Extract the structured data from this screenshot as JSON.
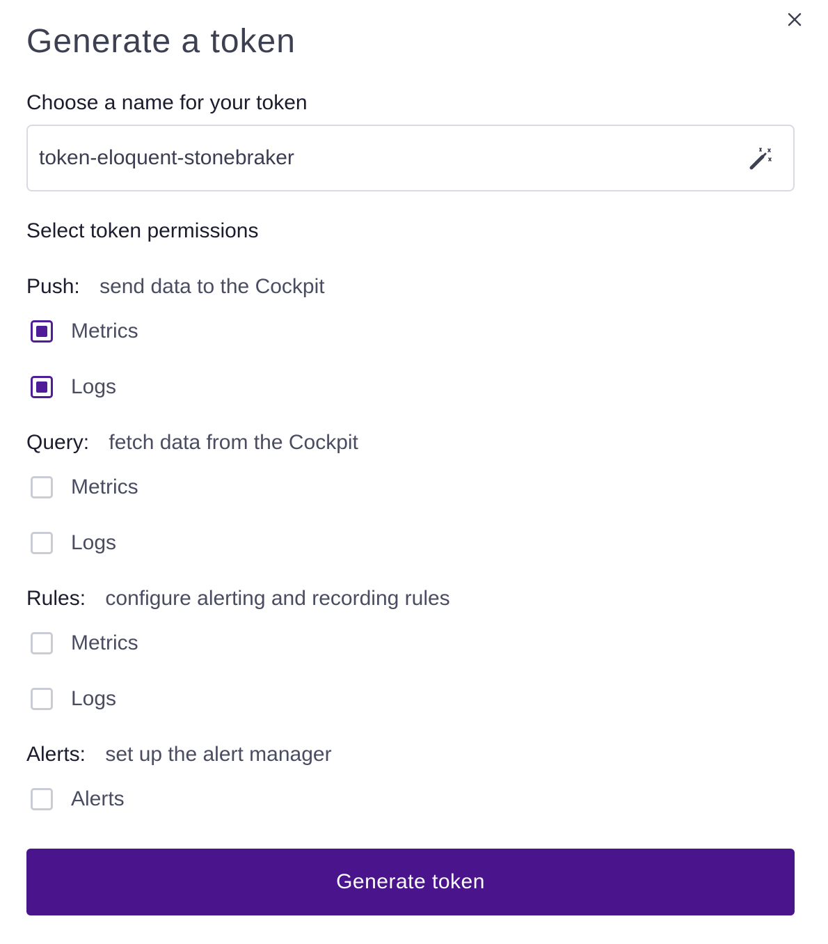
{
  "dialog": {
    "title": "Generate a token",
    "close_icon": "close-icon"
  },
  "name_field": {
    "label": "Choose a name for your token",
    "value": "token-eloquent-stonebraker",
    "wand_icon": "magic-wand-icon"
  },
  "permissions": {
    "label": "Select token permissions",
    "groups": [
      {
        "name": "Push:",
        "description": "send data to the Cockpit",
        "options": [
          {
            "label": "Metrics",
            "checked": true
          },
          {
            "label": "Logs",
            "checked": true
          }
        ]
      },
      {
        "name": "Query:",
        "description": "fetch data from the Cockpit",
        "options": [
          {
            "label": "Metrics",
            "checked": false
          },
          {
            "label": "Logs",
            "checked": false
          }
        ]
      },
      {
        "name": "Rules:",
        "description": "configure alerting and recording rules",
        "options": [
          {
            "label": "Metrics",
            "checked": false
          },
          {
            "label": "Logs",
            "checked": false
          }
        ]
      },
      {
        "name": "Alerts:",
        "description": "set up the alert manager",
        "options": [
          {
            "label": "Alerts",
            "checked": false
          }
        ]
      }
    ]
  },
  "submit": {
    "label": "Generate token"
  },
  "colors": {
    "primary": "#4a148c",
    "checkbox_checked": "#4f1d97",
    "checkbox_border": "#c9cbd6",
    "heading_text": "#1b1c2d",
    "body_text": "#4a4d62"
  }
}
